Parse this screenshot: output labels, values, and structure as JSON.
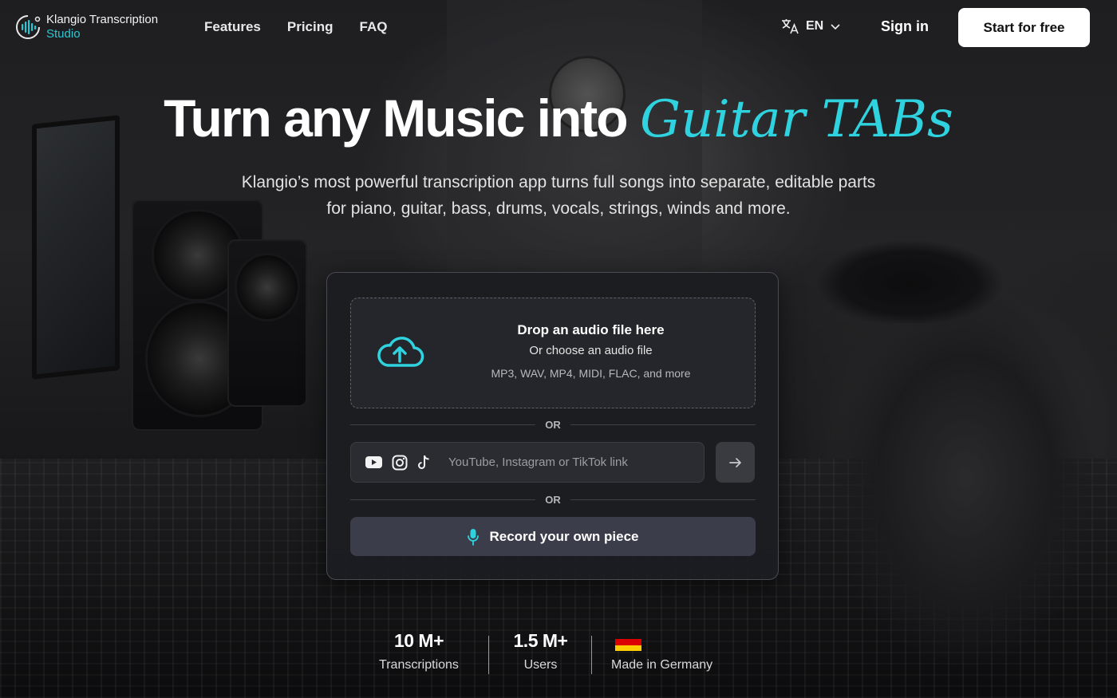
{
  "brand": {
    "line1": "Klangio Transcription",
    "line2": "Studio",
    "accent_color": "#28c9d6"
  },
  "nav": {
    "items": [
      {
        "label": "Features"
      },
      {
        "label": "Pricing"
      },
      {
        "label": "FAQ"
      }
    ]
  },
  "header": {
    "language": "EN",
    "language_icon": "translate-icon",
    "signin_label": "Sign in",
    "cta_label": "Start for free"
  },
  "hero": {
    "title_main": "Turn any Music into",
    "title_accent": "Guitar TABs",
    "subtitle_line1": "Klangio’s most powerful transcription app turns full songs into separate, editable parts",
    "subtitle_line2": "for piano, guitar, bass, drums, vocals, strings, winds and more."
  },
  "upload": {
    "drop_title": "Drop an audio file here",
    "drop_choose": "Or choose an audio file",
    "drop_formats": "MP3, WAV, MP4, MIDI, FLAC, and more",
    "drop_icon": "cloud-upload-icon",
    "or_label_1": "OR",
    "or_label_2": "OR",
    "link_placeholder": "YouTube, Instagram or TikTok link",
    "link_value": "",
    "link_icons": [
      "youtube-icon",
      "instagram-icon",
      "tiktok-icon"
    ],
    "submit_icon": "arrow-right-icon",
    "record_label": "Record your own piece",
    "record_icon": "microphone-icon"
  },
  "stats": [
    {
      "number": "10 M+",
      "label": "Transcriptions"
    },
    {
      "number": "1.5 M+",
      "label": "Users"
    },
    {
      "number": "",
      "label": "Made in Germany",
      "icon": "germany-flag-icon"
    }
  ],
  "colors": {
    "accent": "#2fd3df",
    "card_bg": "#1c1d21",
    "record_button": "#3b3d4a",
    "cta_bg": "#ffffff"
  }
}
